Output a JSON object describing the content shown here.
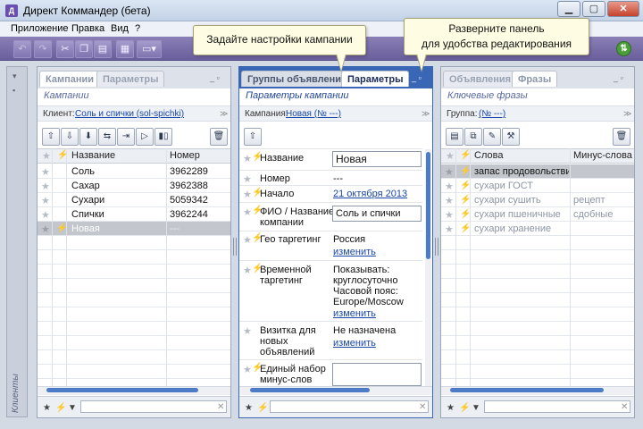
{
  "window": {
    "title": "Директ Коммандер (бета)",
    "app_icon": "Д",
    "minimize": "▁",
    "maximize": "▢",
    "close": "✕"
  },
  "menu": {
    "items": [
      "Приложение",
      "Правка",
      "Вид",
      "?"
    ]
  },
  "toolbar": {
    "buttons": [
      {
        "icon": "undo-icon",
        "glyph": "↶"
      },
      {
        "icon": "redo-icon",
        "glyph": "↷"
      },
      {
        "icon": "cut-icon",
        "glyph": "✂"
      },
      {
        "icon": "copy-icon",
        "glyph": "❐"
      },
      {
        "icon": "paste-icon",
        "glyph": "▤"
      },
      {
        "icon": "columns-icon",
        "glyph": "▦"
      },
      {
        "icon": "view-dropdown-icon",
        "glyph": "▭▾"
      }
    ],
    "sync_glyph": "⇅"
  },
  "tooltips": {
    "left": "Задайте настройки кампании",
    "right_line1": "Разверните панель",
    "right_line2": "для удобства редактирования"
  },
  "clients_strip": {
    "label": "Клиенты",
    "top_glyph": "▾",
    "pin_glyph": "▪"
  },
  "campaigns_panel": {
    "tabs": [
      "Кампании",
      "Параметры"
    ],
    "tab_ctrl": "_ ▫",
    "subtitle": "Кампании",
    "filter_label": "Клиент:",
    "filter_value": "Соль и спички (sol-spichki)",
    "chev": "≫",
    "buttons": [
      {
        "icon": "upload-icon",
        "glyph": "⇧"
      },
      {
        "icon": "download-icon",
        "glyph": "⇩"
      },
      {
        "icon": "import-icon",
        "glyph": "⬇"
      },
      {
        "icon": "copy-campaign-icon",
        "glyph": "⇆"
      },
      {
        "icon": "move-icon",
        "glyph": "⇥"
      },
      {
        "icon": "start-icon",
        "glyph": "▷"
      },
      {
        "icon": "stats-icon",
        "glyph": "▮▯"
      },
      {
        "icon": "delete-icon",
        "glyph": "🗑"
      }
    ],
    "columns": [
      "★",
      "⚡",
      "Название",
      "Номер"
    ],
    "rows": [
      {
        "name": "Соль",
        "number": "3962289"
      },
      {
        "name": "Сахар",
        "number": "3962388"
      },
      {
        "name": "Сухари",
        "number": "5059342"
      },
      {
        "name": "Спички",
        "number": "3962244"
      },
      {
        "name": "Новая",
        "number": "---"
      }
    ],
    "footer_clear": "✕"
  },
  "params_panel": {
    "tabs": [
      "Группы объявлений",
      "Параметры"
    ],
    "tab_ctrl": "_ ▫",
    "subtitle": "Параметры кампании",
    "filter_label": "Кампания:",
    "filter_value": "Новая (№ ---)",
    "chev": "≫",
    "button_glyph": "⇧",
    "fields": {
      "name_label": "Название",
      "name_value": "Новая",
      "number_label": "Номер",
      "number_value": "---",
      "start_label": "Начало",
      "start_value": "21 октября 2013",
      "fio_label_1": "ФИО / Название",
      "fio_label_2": "компании",
      "fio_value": "Соль и спички",
      "geo_label": "Гео таргетинг",
      "geo_value": "Россия",
      "geo_link": "изменить",
      "time_label_1": "Временной",
      "time_label_2": "таргетинг",
      "time_value_1": "Показывать:",
      "time_value_2": "круглосуточно",
      "time_value_3": "Часовой пояс:",
      "time_value_4": "Europe/Moscow",
      "time_link": "изменить",
      "card_label_1": "Визитка для",
      "card_label_2": "новых",
      "card_label_3": "объявлений",
      "card_value": "Не назначена",
      "card_link": "изменить",
      "minus_label_1": "Единый набор",
      "minus_label_2": "минус-слов"
    },
    "footer_clear": "✕"
  },
  "phrases_panel": {
    "tabs": [
      "Объявления",
      "Фразы"
    ],
    "tab_ctrl": "_ ▫",
    "subtitle": "Ключевые фразы",
    "filter_label": "Группа:",
    "filter_value": "(№ ---)",
    "chev": "≫",
    "buttons": [
      {
        "icon": "add-phrase-icon",
        "glyph": "▤"
      },
      {
        "icon": "copy-phrase-icon",
        "glyph": "⧉"
      },
      {
        "icon": "edit-phrase-icon",
        "glyph": "✎"
      },
      {
        "icon": "wordstat-icon",
        "glyph": "⚒"
      },
      {
        "icon": "delete-icon",
        "glyph": "🗑"
      }
    ],
    "columns": [
      "★",
      "⚡",
      "Слова",
      "Минус-слова"
    ],
    "rows": [
      {
        "words": "запас продовольствия",
        "minus": ""
      },
      {
        "words": "сухари ГОСТ",
        "minus": ""
      },
      {
        "words": "сухари сушить",
        "minus": "рецепт"
      },
      {
        "words": "сухари пшеничные",
        "minus": "сдобные"
      },
      {
        "words": "сухари хранение",
        "minus": ""
      }
    ],
    "footer_clear": "✕"
  }
}
